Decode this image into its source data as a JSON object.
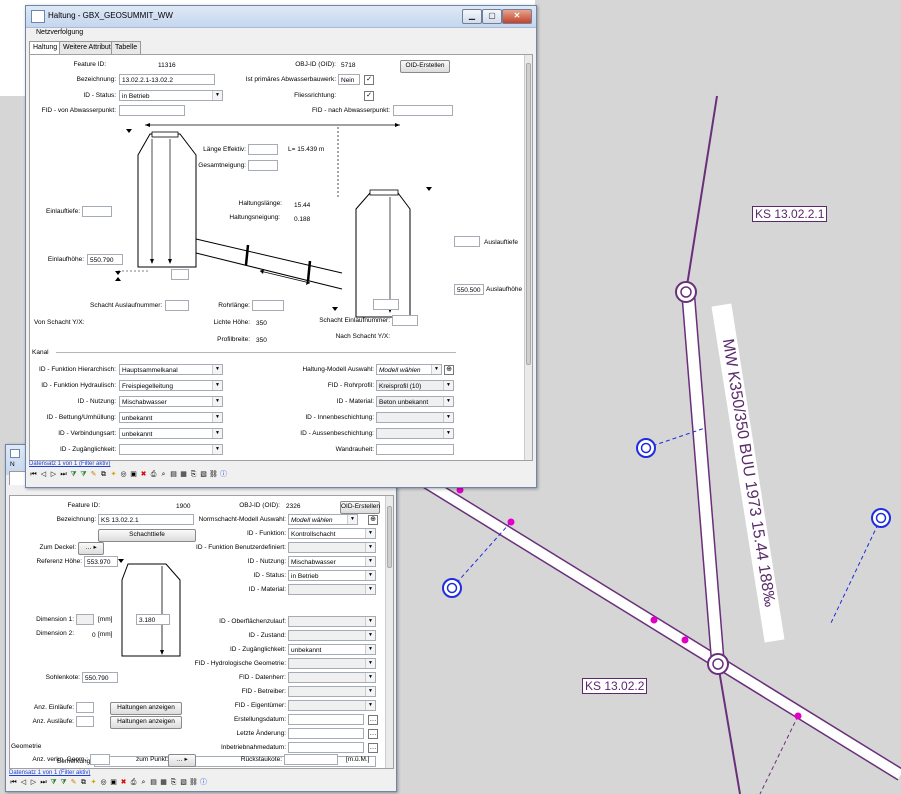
{
  "map": {
    "label_ks1": "KS 13.02.2.1",
    "label_ks2": "KS 13.02.2",
    "pipe_label": "MW K350/350 BUU 1973 15.44 188‰"
  },
  "haltung": {
    "title": "Haltung - GBX_GEOSUMMIT_WW",
    "menu_label": "Netzverfolgung",
    "tabs": [
      "Haltung",
      "Weitere Attribute",
      "Tabelle"
    ],
    "feature_id_label": "Feature ID:",
    "feature_id": "11316",
    "objid_label": "OBJ-ID (OID):",
    "objid": "5718",
    "oid_button": "OID-Erstellen",
    "bezeichnung_label": "Bezeichnung:",
    "bezeichnung": "13.02.2.1-13.02.2",
    "primaer_label": "Ist primäres Abwasserbauwerk:",
    "primaer_value": "Nein",
    "status_label": "ID - Status:",
    "status": "in Betrieb",
    "fliess_label": "Fliessrichtung:",
    "fid_von_label": "FID - von Abwasserpunkt:",
    "fid_nach_label": "FID - nach Abwasserpunkt:",
    "laenge_eff_label": "Länge Effektiv:",
    "laenge_l": "L= 15.439 m",
    "gesamtneigung_label": "Gesamtneigung:",
    "einlauftiefe_label": "Einlauftiefe:",
    "haltungslaenge_label": "Haltungslänge:",
    "haltungslaenge": "15.44",
    "haltungsneigung_label": "Haltungsneigung:",
    "haltungsneigung": "0.188",
    "auslauftiefe_label": "Auslauftiefe",
    "einlaufhoehe_label": "Einlaufhöhe:",
    "einlaufhoehe": "550.790",
    "auslaufhoehe": "550.500",
    "auslaufhoehe_label": "Auslaufhöhe",
    "schacht_auslauf_label": "Schacht Auslaufnummer:",
    "rohrlaenge_label": "Rohrlänge:",
    "von_schacht_label": "Von Schacht Y/X:",
    "lichte_hoehe_label": "Lichte Höhe:",
    "lichte_hoehe": "350",
    "schacht_einlauf_label": "Schacht Einlaufnummer:",
    "nach_schacht_label": "Nach Schacht Y/X:",
    "profilbreite_label": "Profilbreite:",
    "profilbreite": "350",
    "kanal_label": "Kanal",
    "fn_hier_label": "ID - Funktion Hierarchisch:",
    "fn_hier": "Hauptsammelkanal",
    "modell_label": "Haltung-Modell Auswahl:",
    "modell_value": "Modell wählen",
    "fn_hydr_label": "ID - Funktion Hydraulisch:",
    "fn_hydr": "Freispiegelleitung",
    "rohrprofil_label": "FID - Rohrprofil:",
    "rohrprofil": "Kreisprofil (10)",
    "nutzung_label": "ID - Nutzung:",
    "nutzung": "Mischabwasser",
    "material_label": "ID - Material:",
    "material": "Beton unbekannt",
    "bettung_label": "ID - Bettung/Umhüllung:",
    "bettung": "unbekannt",
    "innen_label": "ID - Innenbeschichtung:",
    "verbindung_label": "ID - Verbindungsart:",
    "verbindung": "unbekannt",
    "aussen_label": "ID - Aussenbeschichtung:",
    "zugang_label": "ID - Zugänglichkeit:",
    "wandrauheit_label": "Wandrauheit:",
    "status_bar": "Datensatz 1 von 1 (Filter aktiv)"
  },
  "schacht": {
    "feature_id_label": "Feature ID:",
    "feature_id": "1900",
    "objid_label": "OBJ-ID (OID):",
    "objid": "2326",
    "oid_button": "OID-Erstellen",
    "bezeichnung_label": "Bezeichnung:",
    "bezeichnung": "KS 13.02.2.1",
    "normschacht_label": "Normschacht-Modell Auswahl:",
    "normschacht_value": "Modell wählen",
    "schachttiefe_button": "Schachttiefe",
    "funktion_label": "ID - Funktion:",
    "funktion": "Kontrollschacht",
    "zum_deckel_label": "Zum Deckel:",
    "fn_benutzer_label": "ID - Funktion Benutzerdefiniert:",
    "referenz_label": "Referenz Höhe:",
    "referenz": "553.970",
    "nutzung_label": "ID - Nutzung:",
    "nutzung": "Mischabwasser",
    "status_label": "ID - Status:",
    "status": "in Betrieb",
    "material_label": "ID - Material:",
    "dim1_label": "Dimension 1:",
    "dim1_unit": "[mm]",
    "dim1_value": "3.180",
    "dim2_label": "Dimension 2:",
    "dim2_value": "0",
    "dim2_unit": "[mm]",
    "oberflaeche_label": "ID - Oberflächenzulauf:",
    "zustand_label": "ID - Zustand:",
    "zugaenglichkeit_label": "ID - Zugänglichkeit:",
    "zugaenglichkeit": "unbekannt",
    "hydro_label": "FID - Hydrologische Geometrie:",
    "sohlenkote_label": "Sohlenkote:",
    "sohlenkote": "550.790",
    "datenherr_label": "FID - Datenherr:",
    "betreiber_label": "FID - Betreiber:",
    "anz_einlaeufe_label": "Anz. Einläufe:",
    "haltungen_btn": "Haltungen anzeigen",
    "eigentuemer_label": "FID - Eigentümer:",
    "anz_auslaeufe_label": "Anz. Ausläufe:",
    "erstellung_label": "Erstellungsdatum:",
    "letzte_aenderung_label": "Letzte Änderung:",
    "inbetrieb_label": "Inbetriebnahmedatum:",
    "bemerkung_label": "Bemerkung:",
    "geometrie_label": "Geometrie",
    "anz_verkn_label": "Anz. verkn. Geom.:",
    "zum_punkt_label": "zum Punkt:",
    "rueckstau_label": "Rückstaukote:",
    "rueckstau_unit": "[m.ü.M.]",
    "status_bar": "Datensatz 1 von 1 (Filter aktiv)",
    "title_stub": "N"
  },
  "colors": {
    "pipe": "#6a2f7a",
    "pipe_fill": "#ffffff",
    "node": "#6a2f7a",
    "connector": "#1f2ce0",
    "magenta": "#e000c8",
    "map_bg": "#d6d6d6"
  }
}
